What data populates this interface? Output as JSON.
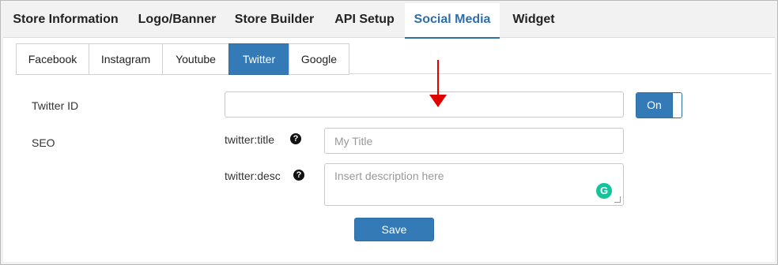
{
  "top_tabs": [
    {
      "label": "Store Information",
      "active": false
    },
    {
      "label": "Logo/Banner",
      "active": false
    },
    {
      "label": "Store Builder",
      "active": false
    },
    {
      "label": "API Setup",
      "active": false
    },
    {
      "label": "Social Media",
      "active": true
    },
    {
      "label": "Widget",
      "active": false
    }
  ],
  "sub_tabs": [
    {
      "label": "Facebook",
      "active": false
    },
    {
      "label": "Instagram",
      "active": false
    },
    {
      "label": "Youtube",
      "active": false
    },
    {
      "label": "Twitter",
      "active": true
    },
    {
      "label": "Google",
      "active": false
    }
  ],
  "form": {
    "twitter_id": {
      "label": "Twitter ID",
      "value": ""
    },
    "toggle": {
      "label": "On",
      "state": "on"
    },
    "seo": {
      "label": "SEO",
      "title": {
        "label": "twitter:title",
        "value": "",
        "placeholder": "My Title",
        "help_icon": "question-circle-icon"
      },
      "desc": {
        "label": "twitter:desc",
        "value": "",
        "placeholder": "Insert description here",
        "help_icon": "question-circle-icon"
      }
    },
    "save_label": "Save"
  },
  "annotation": {
    "icon": "red-down-arrow-icon",
    "color": "#e00000"
  },
  "colors": {
    "accent": "#337ab7",
    "active_tab_text": "#2f6fa8",
    "grammarly": "#15c39a"
  }
}
